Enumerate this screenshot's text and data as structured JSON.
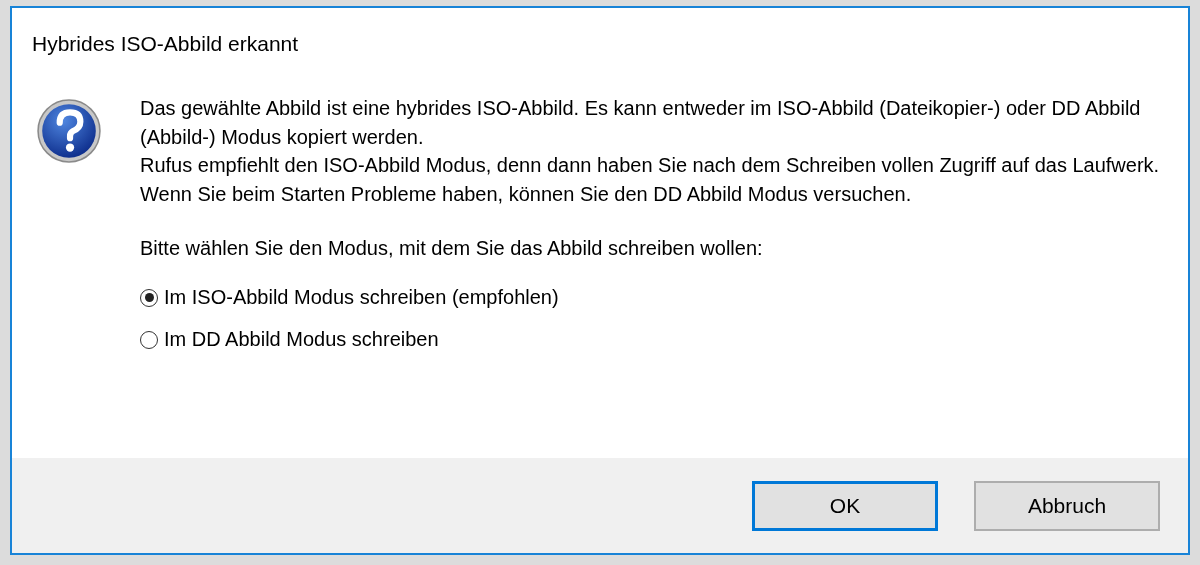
{
  "window": {
    "title": "Hybrides ISO-Abbild erkannt"
  },
  "message": [
    "Das gewählte Abbild ist eine hybrides ISO-Abbild. Es kann entweder im ISO-Abbild (Dateikopier-) oder DD Abbild (Abbild-) Modus kopiert werden.",
    "Rufus empfiehlt den ISO-Abbild Modus, denn dann haben Sie nach dem Schreiben vollen Zugriff auf das Laufwerk.",
    "Wenn Sie beim Starten Probleme haben, können Sie den DD Abbild Modus versuchen."
  ],
  "prompt": "Bitte wählen Sie den Modus, mit dem Sie das Abbild schreiben wollen:",
  "options": [
    {
      "label": "Im ISO-Abbild Modus schreiben (empfohlen)",
      "selected": true
    },
    {
      "label": "Im DD Abbild Modus schreiben",
      "selected": false
    }
  ],
  "buttons": [
    {
      "label": "OK",
      "default": true
    },
    {
      "label": "Abbruch",
      "default": false
    }
  ]
}
